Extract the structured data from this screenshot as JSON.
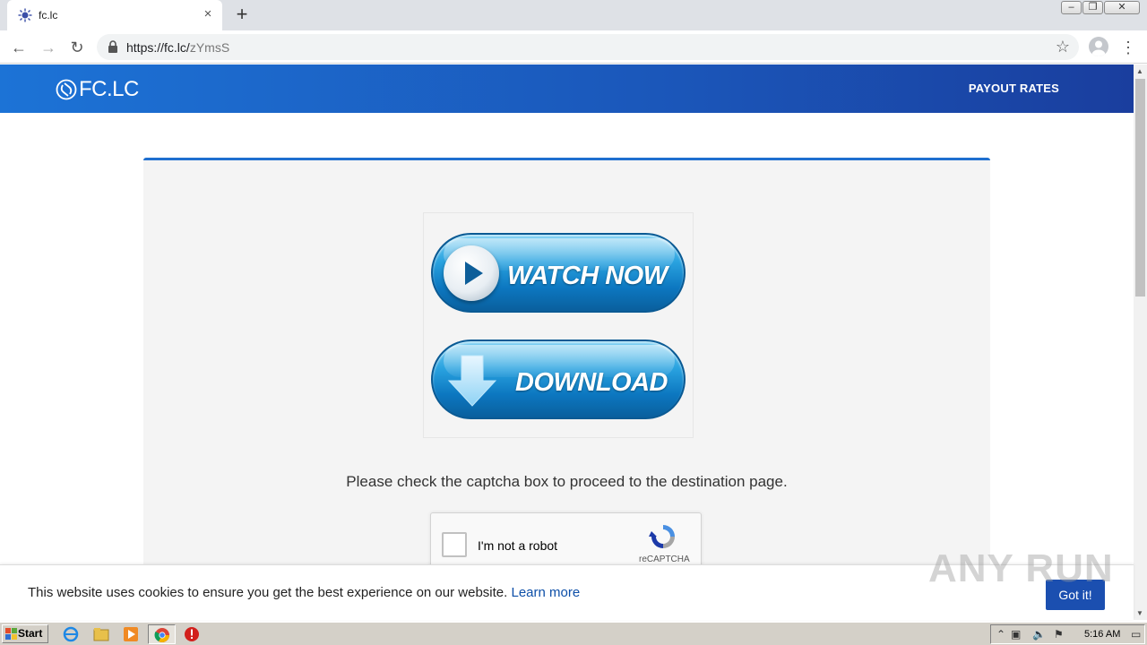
{
  "browser": {
    "tab_title": "fc.lc",
    "tab_close": "×",
    "new_tab": "+",
    "url_host": "https://fc.lc/",
    "url_path": "zYmsS",
    "window_controls": [
      "minimize-icon",
      "restore-icon",
      "close-icon"
    ]
  },
  "site": {
    "logo_text": "FC.LC",
    "nav_payout": "PAYOUT RATES"
  },
  "ad": {
    "watch_label": "WATCH NOW",
    "download_label": "DOWNLOAD"
  },
  "instructions": "Please check the captcha box to proceed to the destination page.",
  "captcha": {
    "label": "I'm not a robot",
    "brand": "reCAPTCHA"
  },
  "cookie_banner": {
    "message": "This website uses cookies to ensure you get the best experience on our website.",
    "learn_more": "Learn more",
    "accept": "Got it!"
  },
  "watermark": "ANY RUN",
  "taskbar": {
    "start_label": "Start",
    "clock": "5:16 AM"
  },
  "colors": {
    "header_start": "#1c73d6",
    "header_end": "#1a3e9e",
    "accent": "#1f6fcf",
    "button_blue": "#1b4fb0"
  }
}
